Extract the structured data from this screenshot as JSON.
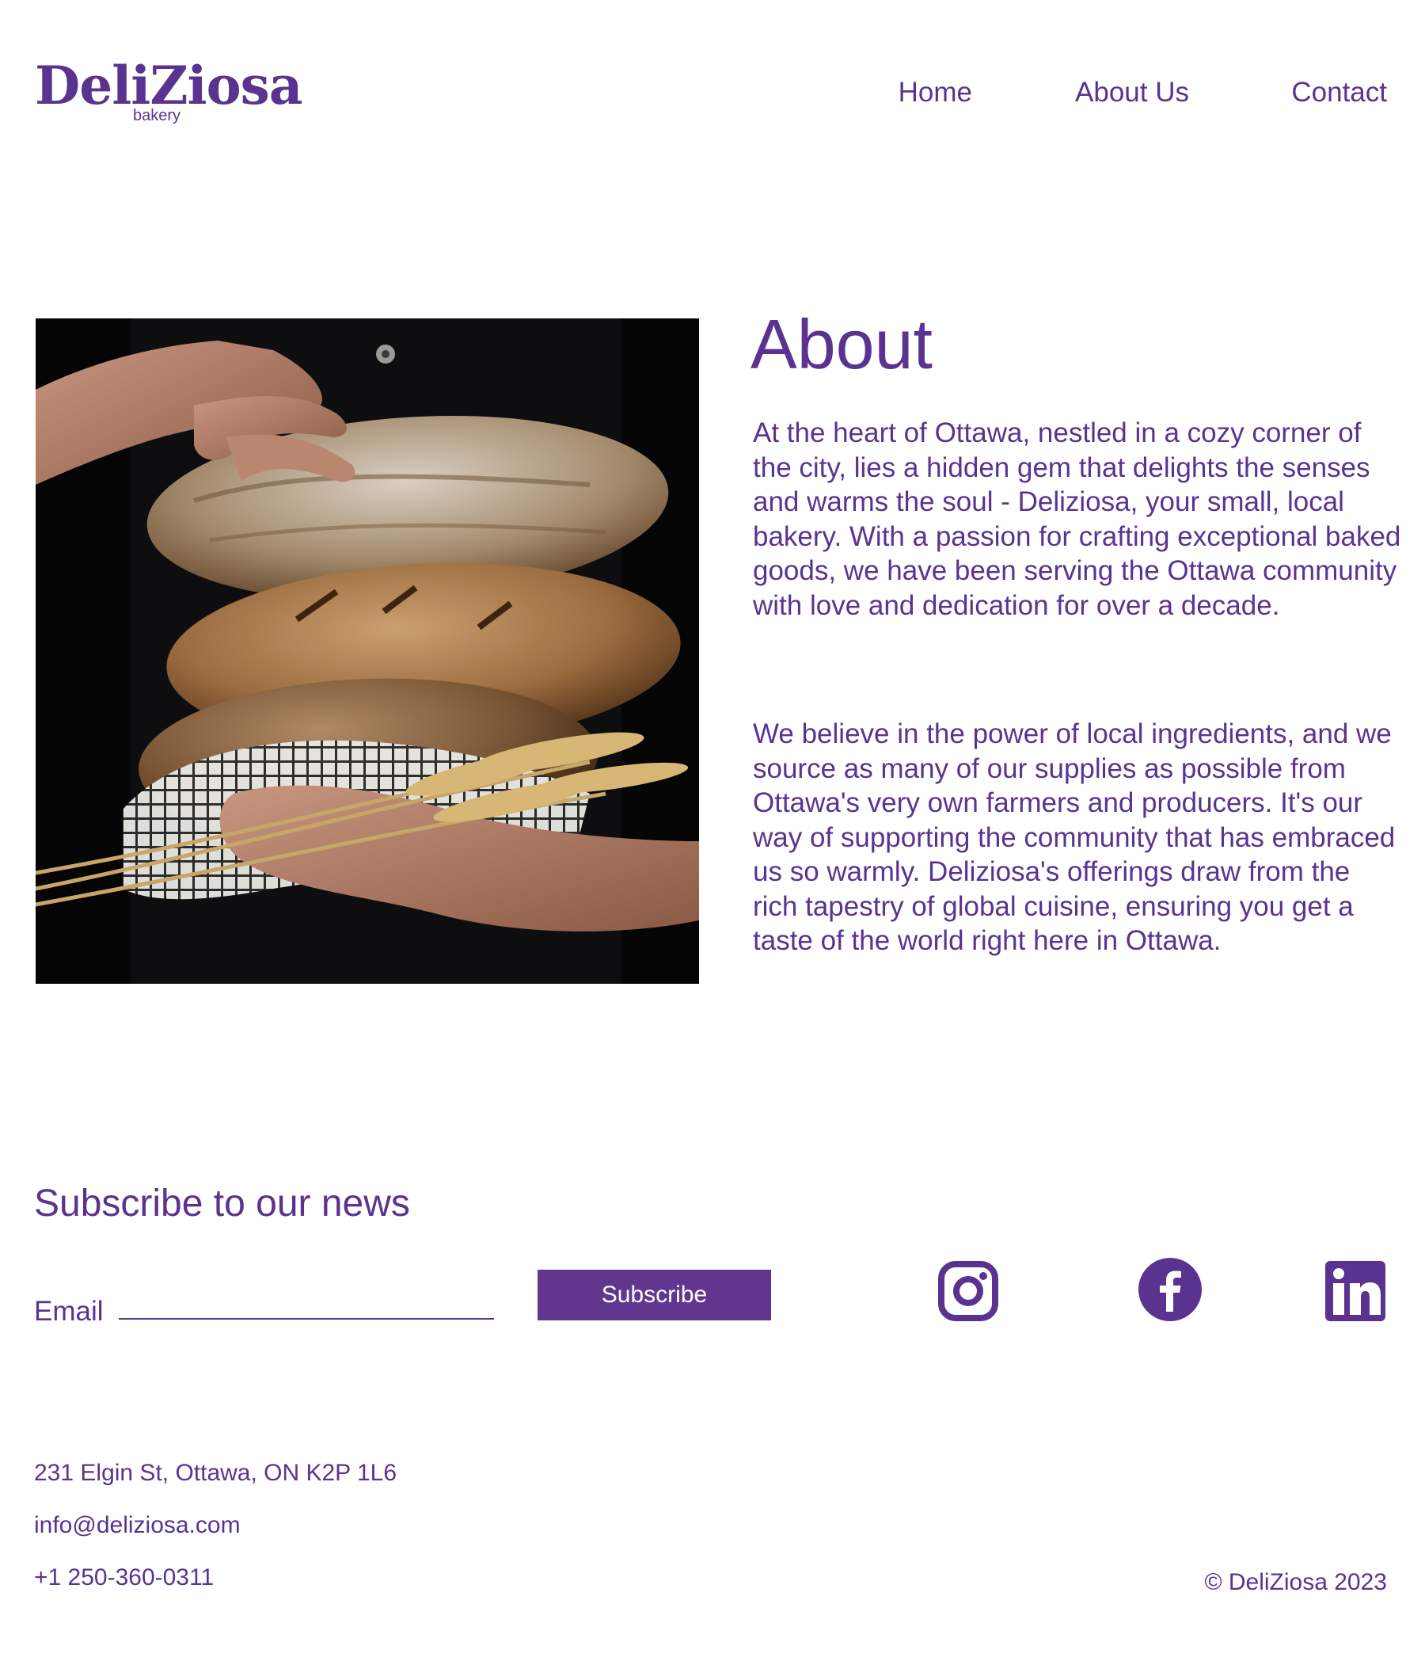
{
  "header": {
    "logo_text": "DeliZiosa",
    "logo_sub": "bakery",
    "nav": {
      "home": "Home",
      "about": "About Us",
      "contact": "Contact"
    }
  },
  "about": {
    "title": "About",
    "paragraph_1": "At the heart of Ottawa, nestled in a cozy corner of the city, lies a hidden gem that delights the senses and warms the soul - Deliziosa, your small, local bakery. With a passion for crafting exceptional baked goods, we have been serving the Ottawa community with love and dedication for over a decade.",
    "paragraph_2": "We believe in the power of local ingredients, and we source as many of our supplies as possible from Ottawa's very own farmers and producers. It's our way of supporting the community that has embraced us so warmly. Deliziosa's offerings draw from the rich tapestry of global cuisine, ensuring you get a taste of the world right here in Ottawa."
  },
  "subscribe": {
    "title": "Subscribe to our news",
    "email_label": "Email",
    "email_value": "",
    "button_label": "Subscribe"
  },
  "social": {
    "icons": [
      "instagram-icon",
      "facebook-icon",
      "linkedin-icon"
    ]
  },
  "footer": {
    "address": "231 Elgin St, Ottawa, ON K2P 1L6",
    "email": "info@deliziosa.com",
    "phone": "+1 250-360-0311",
    "copyright": "© DeliZiosa 2023"
  },
  "colors": {
    "brand_purple": "#5a3391",
    "button_purple": "#62368f",
    "background": "#ffffff"
  }
}
